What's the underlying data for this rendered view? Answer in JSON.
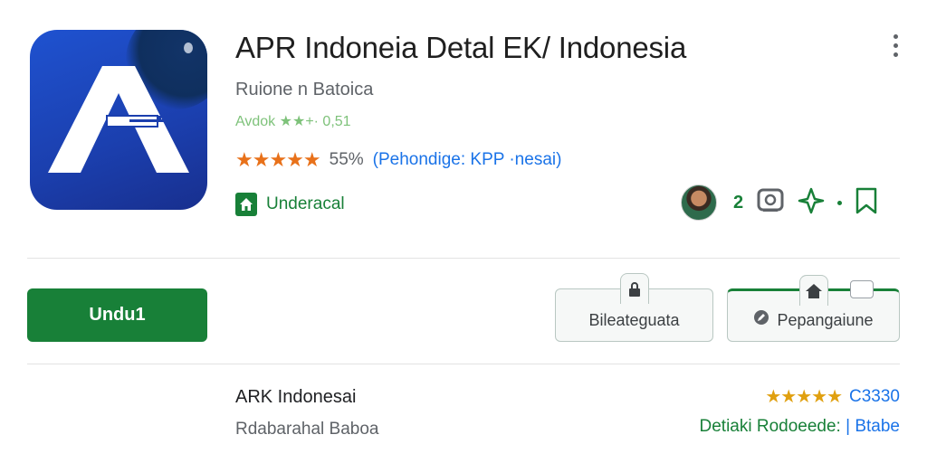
{
  "app": {
    "title": "APR Indoneia Detal EK/ Indonesia",
    "developer": "Ruione n Batoica",
    "meta": "Avdok ★★+· 0,51",
    "stars": "★★★★★",
    "rating_percent": "55%",
    "rating_note": "(Pehondige: KPP ·nesai)",
    "tag_label": "Underacal",
    "action_count": "2"
  },
  "buttons": {
    "install_label": "Undu1",
    "secondary_label": "Bileateguata",
    "tertiary_label": "Pepangaiune"
  },
  "related": {
    "title": "ARK Indonesai",
    "subtitle": "Rdabarahal Baboa",
    "stars": "★★★★★",
    "rating_count": "C3330",
    "detail_label": "Detiaki Rodoeede: ",
    "detail_link": "| Btabe"
  },
  "colors": {
    "accent_green": "#188038",
    "star_orange": "#e8711a",
    "link_blue": "#1a73e8",
    "icon_blue": "#1f52d0"
  },
  "icons": [
    "app-logo-icon",
    "more-vert-icon",
    "home-tag-icon",
    "avatar",
    "screen-icon",
    "sparkle-icon",
    "bookmark-icon",
    "lock-icon",
    "home-icon",
    "edit-icon"
  ]
}
